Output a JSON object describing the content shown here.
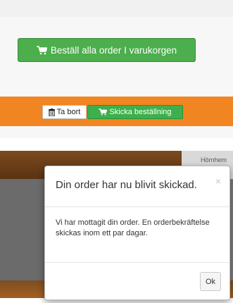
{
  "cart": {
    "order_all_label": "Beställ alla order I varukorgen",
    "cart_icon": "shopping-cart-icon"
  },
  "order_row": {
    "delete_label": "Ta bort",
    "delete_icon": "trash-icon",
    "send_label": "Skicka beställning",
    "send_icon": "shopping-cart-icon"
  },
  "background": {
    "nav_link": "Hörnhem"
  },
  "modal": {
    "title": "Din order har nu blivit skickad.",
    "close_label": "×",
    "body": "Vi har mottagit din order. En orderbekräftelse skickas inom ett par dagar.",
    "ok_label": "Ok"
  },
  "colors": {
    "accent_green": "#4cae4c",
    "orange_bar": "#f08521",
    "modal_bg": "#ffffff"
  }
}
